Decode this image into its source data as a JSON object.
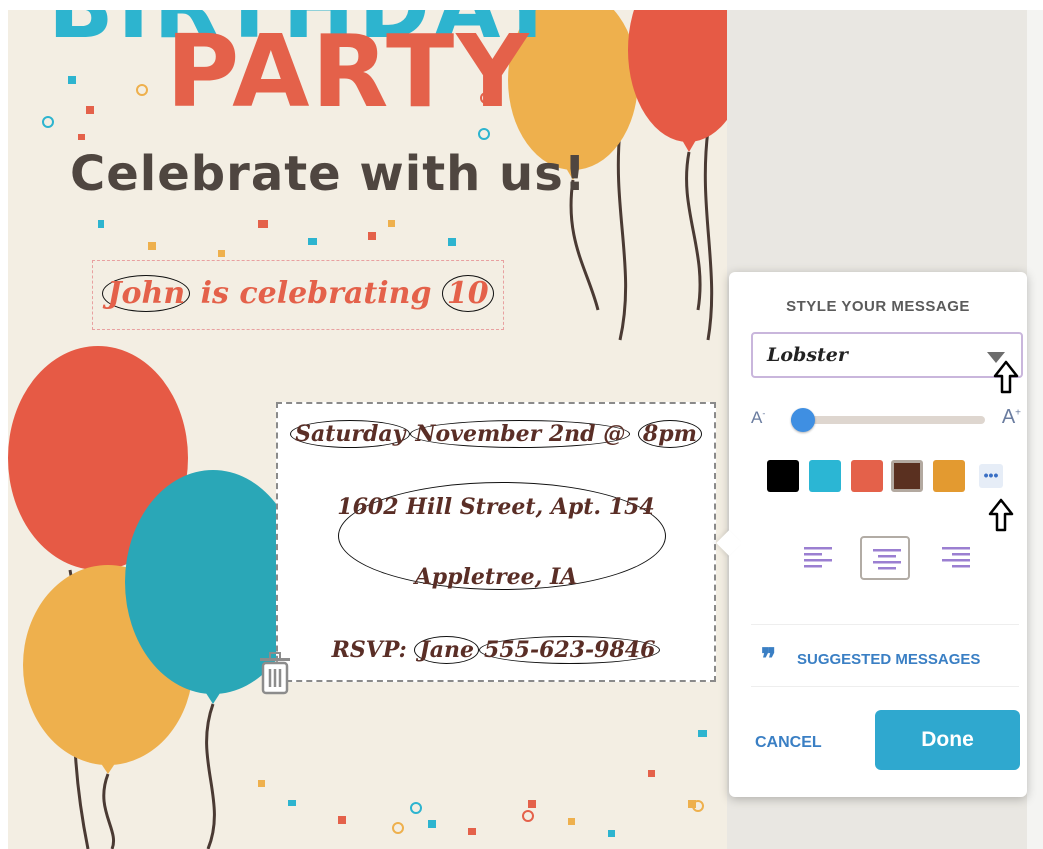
{
  "card": {
    "title_top": "BIRTHDAY",
    "title_main": "PARTY",
    "subtitle": "Celebrate with us!",
    "name_line": {
      "name": "John",
      "middle": "is celebrating",
      "age": "10"
    },
    "message": {
      "day": "Saturday",
      "date": "November 2nd",
      "at": "@",
      "time": "8pm",
      "address_line1": "1602 Hill Street, Apt. 154",
      "address_line2": "Appletree, IA",
      "rsvp_label": "RSVP:",
      "rsvp_name": "Jane",
      "rsvp_phone": "555-623-9846"
    },
    "colors": {
      "background": "#f3eee3",
      "teal": "#2db4cf",
      "coral": "#e4614a",
      "orange": "#e9a93f",
      "brown_text": "#5a2e26"
    }
  },
  "style_panel": {
    "title": "STYLE YOUR MESSAGE",
    "font_select": {
      "value": "Lobster"
    },
    "font_size": {
      "decrease_label": "A",
      "increase_label": "A",
      "level": 0.06
    },
    "color_swatches": [
      {
        "name": "black",
        "color": "#000000",
        "selected": false
      },
      {
        "name": "teal",
        "color": "#2bb6d4",
        "selected": false
      },
      {
        "name": "coral",
        "color": "#e4614a",
        "selected": false
      },
      {
        "name": "brown",
        "color": "#5a3020",
        "selected": true
      },
      {
        "name": "orange",
        "color": "#e39a30",
        "selected": false
      }
    ],
    "more_colors_label": "•••",
    "alignment": [
      "left",
      "center",
      "right"
    ],
    "alignment_selected": "center",
    "suggested_label": "SUGGESTED MESSAGES",
    "quote_glyph": "❞",
    "cancel_label": "CANCEL",
    "done_label": "Done"
  }
}
